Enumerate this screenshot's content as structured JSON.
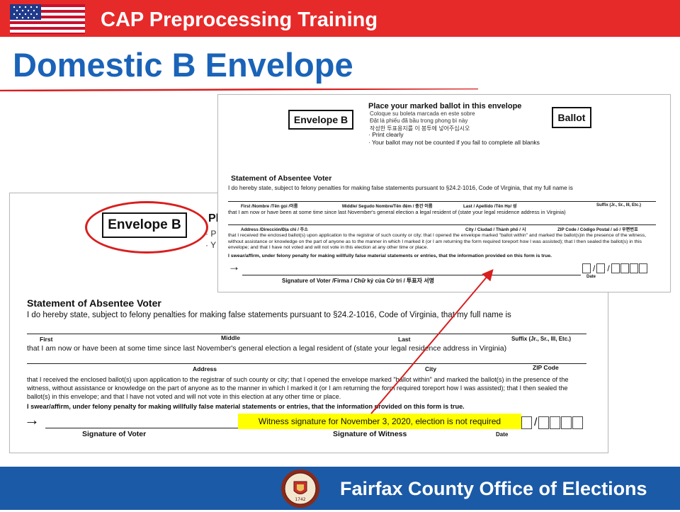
{
  "header": {
    "banner_title": "CAP Preprocessing Training",
    "slide_title": "Domestic B Envelope"
  },
  "large_envelope": {
    "envelope_label": "Envelope B",
    "partial_heading": "Pl",
    "partial_bullet_1": "· P",
    "partial_bullet_2": "· Y",
    "statement_heading": "Statement of Absentee Voter",
    "statement_line": "I do hereby state, subject to felony penalties for making false statements pursuant to §24.2-1016, Code of Virginia, that my full name is",
    "field_first": "First",
    "field_middle": "Middle",
    "field_last": "Last",
    "field_suffix": "Suffix (Jr., Sr., III, Etc.)",
    "resident_line": "that I am now or have been at some time since last November's general election a legal resident of (state your legal residence address in Virginia)",
    "field_address": "Address",
    "field_city": "City",
    "field_zip": "ZIP Code",
    "body_text": "that I received the enclosed ballot(s) upon application to the registrar of such county or city; that I opened the envelope marked \"ballot within\" and marked the ballot(s) in the presence of the witness, without assistance or knowledge on the part of anyone as to the manner in which I marked it (or I am returning the form required toreport how I was assisted); that I then sealed the ballot(s) in this envelope; and that I have not voted and will not vote in this election at any other time or place.",
    "swear_text": "I swear/affirm, under felony penalty for making willfully false material statements or entries, that the information provided on this form is true.",
    "arrow": "→",
    "signature_voter": "Signature of Voter",
    "signature_witness": "Signature of Witness",
    "date_label": "Date"
  },
  "small_envelope": {
    "envelope_label": "Envelope B",
    "ballot_label": "Ballot",
    "heading": "Place your marked ballot in this envelope",
    "heading_es": "Coloque su boleta marcada en este sobre",
    "heading_vi": "Đặt lá phiếu đã bầu trong phong bì này",
    "heading_ko": "작성한 투표용지를 이 봉투에 넣어주십시오",
    "bullet_1": "· Print clearly",
    "bullet_2": "· Your ballot may not be counted if you fail to complete all blanks",
    "statement_heading": "Statement of Absentee Voter",
    "statement_line": "I do hereby state, subject to felony penalties for making false statements pursuant to §24.2-1016, Code of Virginia, that my full name is",
    "field_first": "First /Nombre /Tên gọi /이름",
    "field_middle": "Middle/ Segudo Nombre/Tên đệm / 중간 이름",
    "field_last": "Last / Apellido /Tên Họ/ 성",
    "field_suffix": "Suffix (Jr., Sr., III, Etc.)",
    "resident_line": "that I am now or have been at some time since last November's general election a legal resident of (state your legal residence address in Virginia)",
    "field_address": "Address /Dirección/Địa chỉ / 주소",
    "field_city": "City / Ciudad / Thành phố / 시",
    "field_zip": "ZIP Code / Código Postal / số / 우편번호",
    "body_text": "that I received the enclosed ballot(s) upon application to the registrar of such county or city; that I opened the envelope marked \"ballot within\" and marked the ballot(s)in the presence of the witness, without assistance or knowledge on the part of anyone as to the manner in which I marked it (or I am returning the form required toreport how I was assisted); that I then sealed the ballot(s) in this envelope; and that I have not voted and will not vote in this election at any other time or place.",
    "swear_text": "I swear/affirm, under felony penalty for making willfully false material statements or entries, that the information provided on this form is true.",
    "arrow": "→",
    "signature_voter": "Signature of Voter /Firma / Chữ ký của Cử tri / 투표자 서명",
    "date_label": "Date"
  },
  "callout": {
    "text": "Witness signature for November  3, 2020, election is not required",
    "color": "#ffff00",
    "arrow_color": "#d81e1e"
  },
  "footer": {
    "seal_icon": "county-seal-icon",
    "seal_year": "1742",
    "office_name": "Fairfax County Office of Elections"
  },
  "colors": {
    "banner_red": "#e62a2a",
    "title_blue": "#1a63b8",
    "footer_blue": "#1b5aa6"
  }
}
